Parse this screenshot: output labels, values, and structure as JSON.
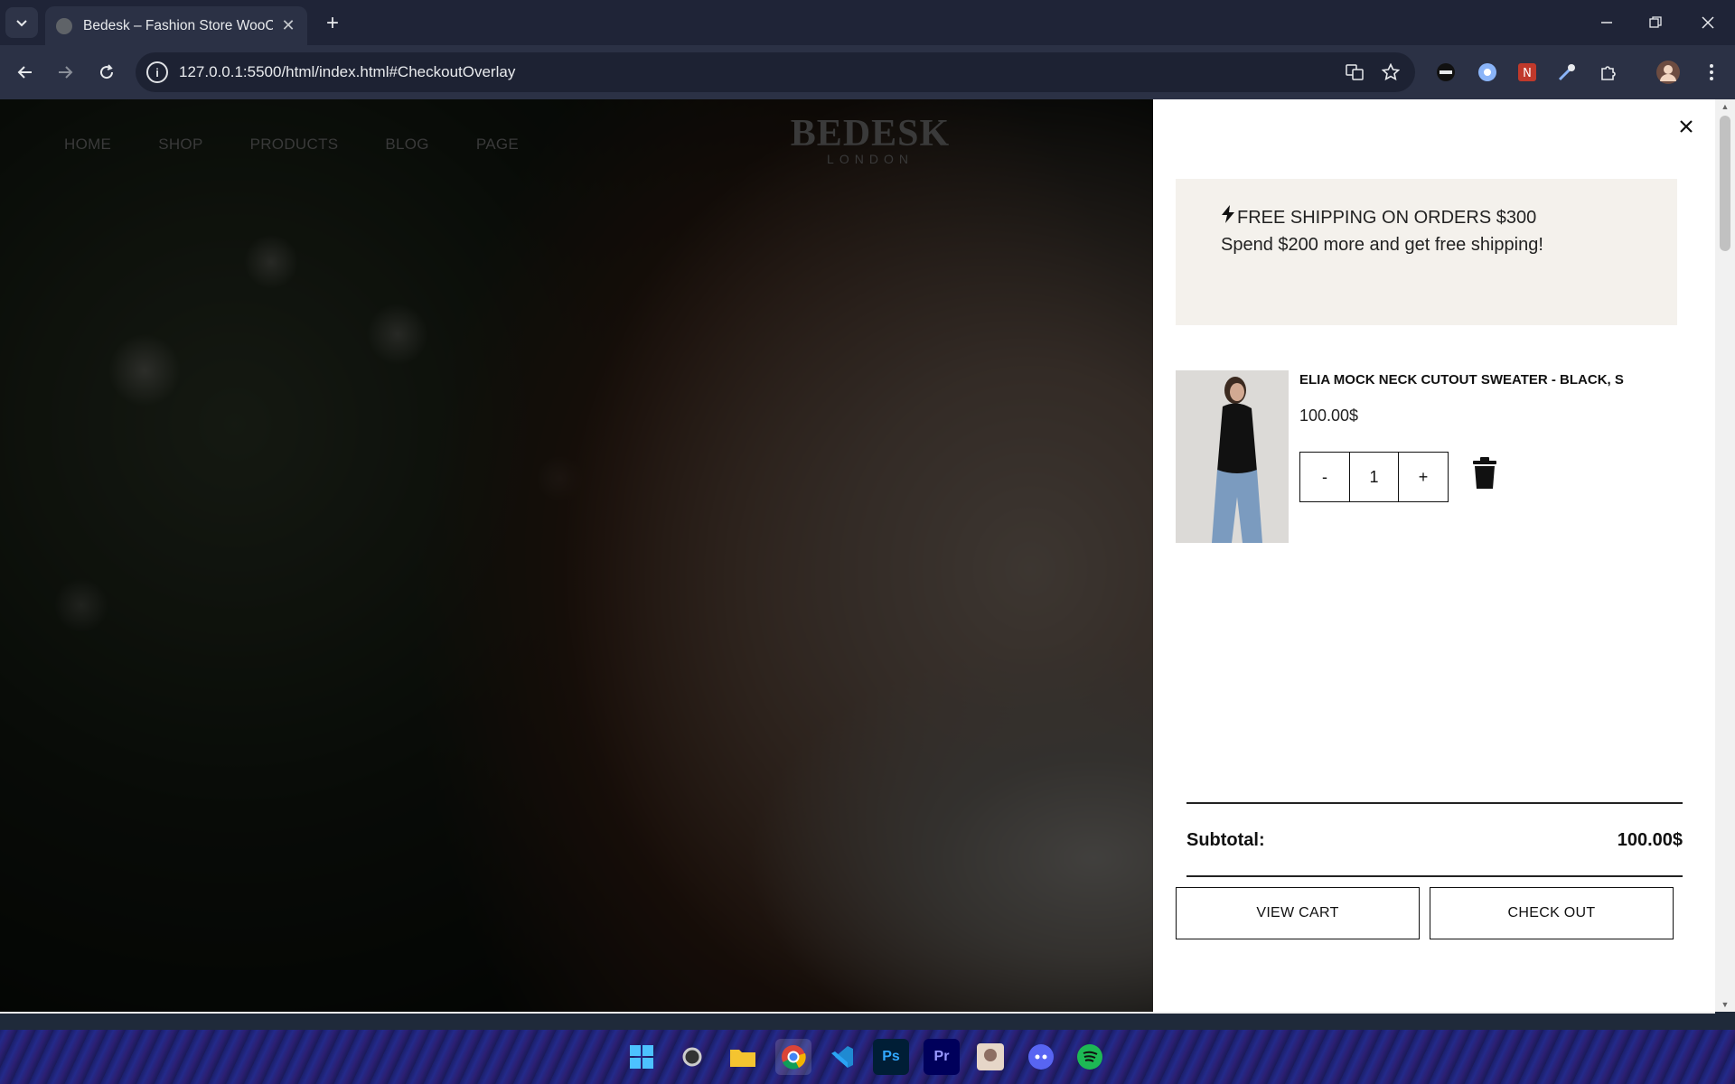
{
  "browser": {
    "tab_title": "Bedesk – Fashion Store WooCommerce",
    "url": "127.0.0.1:5500/html/index.html#CheckoutOverlay"
  },
  "site": {
    "nav": [
      "HOME",
      "SHOP",
      "PRODUCTS",
      "BLOG",
      "PAGE"
    ],
    "logo_main": "BEDESK",
    "logo_sub": "LONDON"
  },
  "cart": {
    "shipping_title": "FREE SHIPPING ON ORDERS $300",
    "shipping_message": "Spend $200 more and get free shipping!",
    "item": {
      "name": "ELIA MOCK NECK CUTOUT SWEATER - BLACK, S",
      "price": "100.00$",
      "qty": "1",
      "minus": "-",
      "plus": "+"
    },
    "subtotal_label": "Subtotal:",
    "subtotal_value": "100.00$",
    "view_cart": "VIEW CART",
    "checkout": "CHECK OUT",
    "close": "×"
  },
  "taskbar": {
    "apps": [
      "start",
      "search",
      "file-explorer",
      "chrome",
      "vscode",
      "photoshop",
      "premiere",
      "game",
      "discord",
      "spotify"
    ]
  }
}
